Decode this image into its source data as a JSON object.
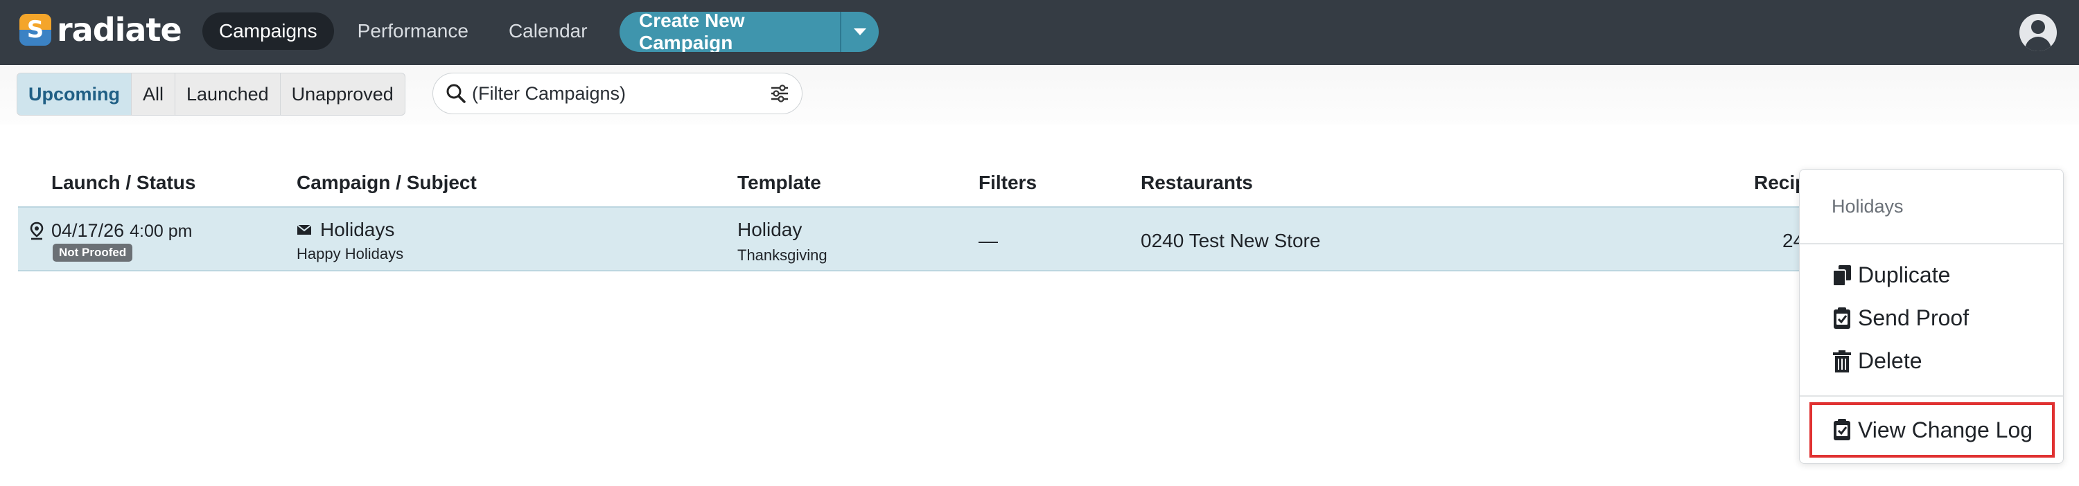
{
  "app": {
    "logo_text": "radiate",
    "logo_glyph": "S"
  },
  "nav": {
    "items": [
      {
        "label": "Campaigns",
        "active": true
      },
      {
        "label": "Performance",
        "active": false
      },
      {
        "label": "Calendar",
        "active": false
      }
    ]
  },
  "create_button": {
    "label": "Create New Campaign"
  },
  "filters": {
    "tabs": [
      {
        "label": "Upcoming",
        "active": true
      },
      {
        "label": "All",
        "active": false
      },
      {
        "label": "Launched",
        "active": false
      },
      {
        "label": "Unapproved",
        "active": false
      }
    ],
    "search_placeholder": "(Filter Campaigns)"
  },
  "table": {
    "headers": {
      "launch": "Launch / Status",
      "campaign": "Campaign / Subject",
      "template": "Template",
      "filters": "Filters",
      "restaurants": "Restaurants",
      "recipients": "Recip"
    },
    "rows": [
      {
        "date": "04/17/26",
        "time": "4:00 pm",
        "status": "Not Proofed",
        "campaign": "Holidays",
        "subject": "Happy Holidays",
        "template": "Holiday",
        "template_sub": "Thanksgiving",
        "filters": "—",
        "restaurants": "0240 Test New Store",
        "recipients": "24"
      }
    ]
  },
  "menu": {
    "title": "Holidays",
    "items": [
      {
        "label": "Duplicate",
        "icon": "duplicate-icon"
      },
      {
        "label": "Send Proof",
        "icon": "check-clipboard-icon"
      },
      {
        "label": "Delete",
        "icon": "trash-icon"
      },
      {
        "label": "View Change Log",
        "icon": "check-clipboard-icon",
        "highlighted": true
      }
    ]
  },
  "colors": {
    "topbar": "#353c44",
    "accent": "#3f95ad",
    "row_selected": "#d8e9ef",
    "highlight_border": "#e03131"
  }
}
